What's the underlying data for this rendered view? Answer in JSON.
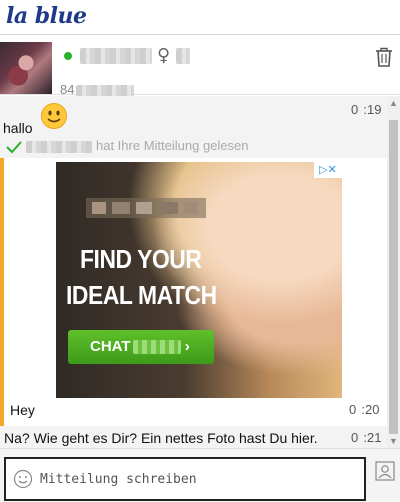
{
  "app": {
    "logo_text": "la blue"
  },
  "contact": {
    "name": "xxxxxxxx",
    "gender_symbol": "♀",
    "age": "xx",
    "meta_prefix": "84",
    "meta_value": "xxxxxxxx",
    "online_color": "#2bb02b"
  },
  "messages": [
    {
      "text": "hallo",
      "time": "0  :19",
      "emoji": "smiley-icon",
      "read_name": "xxxxxxxx",
      "read_text": "hat Ihre Mitteilung gelesen"
    },
    {
      "text": "Hey",
      "time": "0  :20",
      "ad": {
        "headline_1": "FIND YOUR",
        "headline_2": "IDEAL MATCH",
        "cta": "CHAT",
        "accent": "#f2a72a"
      }
    },
    {
      "text": "Na? Wie geht es Dir? Ein nettes Foto hast Du hier.",
      "time": "0  :21"
    }
  ],
  "composer": {
    "placeholder": "Mitteilung schreiben"
  }
}
